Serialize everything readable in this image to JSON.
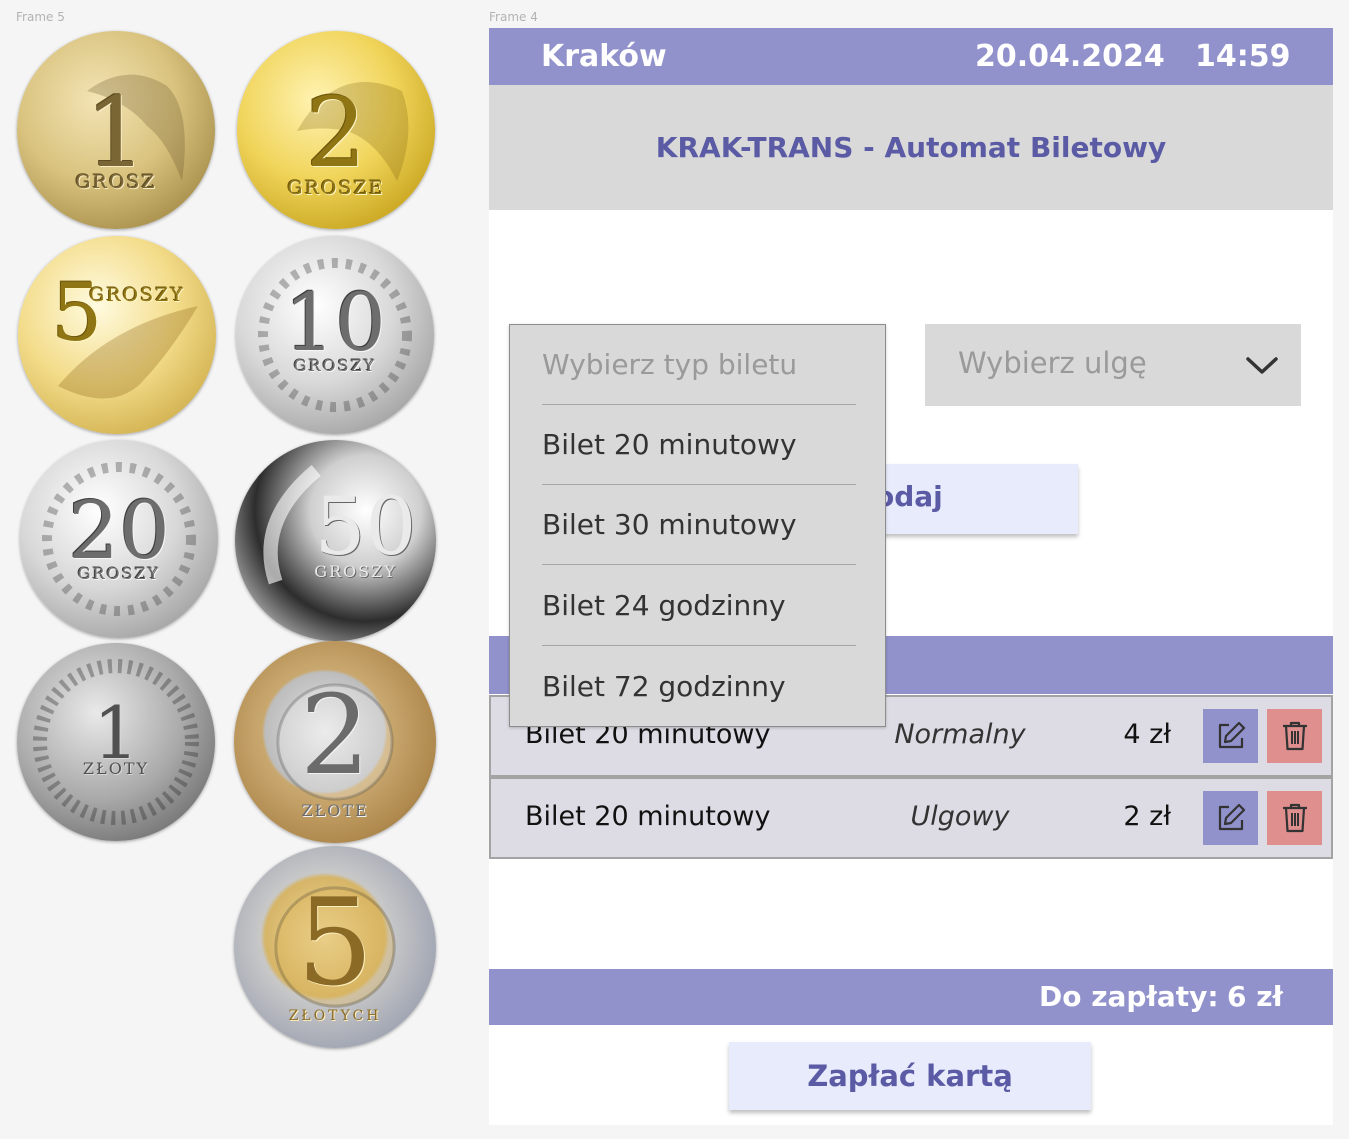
{
  "frames": {
    "left": "Frame 5",
    "right": "Frame 4"
  },
  "coins": [
    {
      "value": "1",
      "label": "GROSZ"
    },
    {
      "value": "2",
      "label": "GROSZE"
    },
    {
      "value": "5",
      "label": "GROSZY"
    },
    {
      "value": "10",
      "label": "GROSZY"
    },
    {
      "value": "20",
      "label": "GROSZY"
    },
    {
      "value": "50",
      "label": "GROSZY"
    },
    {
      "value": "1",
      "label": "ZŁOTY"
    },
    {
      "value": "2",
      "label": "ZŁOTE"
    },
    {
      "value": "5",
      "label": "ZŁOTYCH"
    }
  ],
  "header": {
    "city": "Kraków",
    "date": "20.04.2024",
    "time": "14:59"
  },
  "title": "KRAK-TRANS - Automat Biletowy",
  "ticket_select": {
    "placeholder": "Wybierz typ biletu",
    "options": [
      "Bilet 20 minutowy",
      "Bilet 30 minutowy",
      "Bilet 24 godzinny",
      "Bilet 72 godzinny"
    ]
  },
  "discount_select": {
    "placeholder": "Wybierz ulgę"
  },
  "add_button": "odaj",
  "cart": [
    {
      "name": "Bilet 20 minutowy",
      "kind": "Normalny",
      "price": "4 zł"
    },
    {
      "name": "Bilet 20 minutowy",
      "kind": "Ulgowy",
      "price": "2 zł"
    }
  ],
  "total": {
    "label": "Do zapłaty:",
    "value": "6 zł"
  },
  "pay_button": "Zapłać kartą",
  "colors": {
    "accent": "#9191cc",
    "panel": "#d9d9d9",
    "button_bg": "#e8ebfb",
    "button_text": "#5a5aa5",
    "delete": "#e08f8f"
  }
}
